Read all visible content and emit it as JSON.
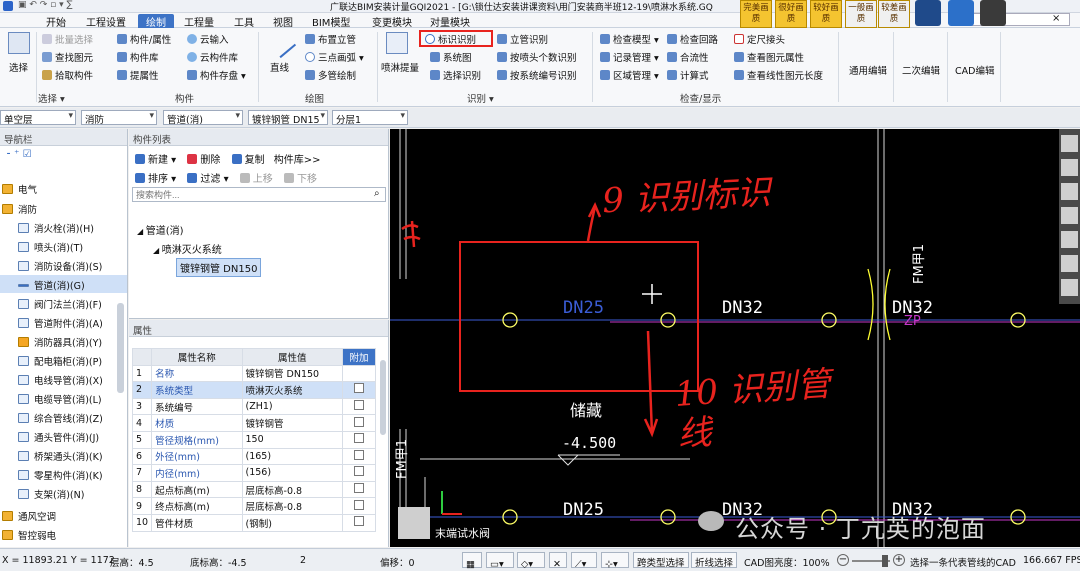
{
  "title_bar": {
    "title": "广联达BIM安装计量GQI2021 - [G:\\锁仕达安装讲课资料\\用门安装商半班12-19\\喷淋水系统.GQ"
  },
  "menu": [
    "开始",
    "工程设置",
    "绘制",
    "工程量",
    "工具",
    "视图",
    "BIM模型",
    "变更模块",
    "对量模块"
  ],
  "badges": [
    "完美画质",
    "很好画质",
    "较好画质",
    "一般画质",
    "较差画质"
  ],
  "ribbon": {
    "select": {
      "btn": "选择",
      "group": "选择 ▾"
    },
    "component": {
      "items": [
        "批量选择",
        "查找图元",
        "拾取构件",
        "构件/属性",
        "构件库",
        "提属性",
        "云输入",
        "云构件库",
        "构件存盘 ▾"
      ],
      "group": "构件"
    },
    "draw": {
      "items": [
        "直线",
        "布置立管",
        "三点画弧 ▾",
        "多管绘制"
      ],
      "group": "绘图"
    },
    "identify": {
      "items": [
        "喷淋提量",
        "标识识别",
        "立管识别",
        "系统图",
        "按喷头个数识别",
        "选择识别",
        "按系统编号识别"
      ],
      "group": "识别 ▾"
    },
    "check": {
      "items": [
        "检查模型 ▾",
        "检查回路",
        "定尺接头",
        "记录管理 ▾",
        "合流性",
        "查看图元属性",
        "区域管理 ▾",
        "计算式",
        "查看线性图元长度"
      ],
      "group": "检查/显示"
    },
    "edit": [
      "通用编辑",
      "二次编辑",
      "CAD编辑"
    ]
  },
  "toolbar": [
    "单空层",
    "消防",
    "管道(消)",
    "镀锌钢管 DN15",
    "分层1"
  ],
  "nav": {
    "header": "导航栏",
    "categories": [
      "电气",
      "消防"
    ],
    "items": [
      "消火栓(消)(H)",
      "喷头(消)(T)",
      "消防设备(消)(S)",
      "管道(消)(G)",
      "阀门法兰(消)(F)",
      "管道附件(消)(A)",
      "消防器具(消)(Y)",
      "配电箱柜(消)(P)",
      "电线导管(消)(X)",
      "电缆导管(消)(L)",
      "综合管线(消)(Z)",
      "通头管件(消)(J)",
      "桥架通头(消)(K)",
      "零星构件(消)(K)",
      "支架(消)(N)"
    ],
    "bottom_categories": [
      "通风空调",
      "智控弱电"
    ]
  },
  "component_list": {
    "header": "构件列表",
    "toolbar1": [
      "新建 ▾",
      "删除",
      "复制",
      "构件库>>"
    ],
    "toolbar2": [
      "排序 ▾",
      "过滤 ▾",
      "上移",
      "下移"
    ],
    "search_placeholder": "搜索构件...",
    "tree": [
      "管道(消)",
      "喷淋灭火系统",
      "镀锌钢管 DN150"
    ]
  },
  "properties": {
    "header": "属性",
    "columns": [
      "属性名称",
      "属性值",
      "附加"
    ],
    "rows": [
      {
        "n": "1",
        "name": "名称",
        "value": "镀锌钢管 DN150"
      },
      {
        "n": "2",
        "name": "系统类型",
        "value": "喷淋灭火系统"
      },
      {
        "n": "3",
        "name": "系统编号",
        "value": "(ZH1)"
      },
      {
        "n": "4",
        "name": "材质",
        "value": "镀锌钢管"
      },
      {
        "n": "5",
        "name": "管径规格(mm)",
        "value": "150"
      },
      {
        "n": "6",
        "name": "外径(mm)",
        "value": "(165)"
      },
      {
        "n": "7",
        "name": "内径(mm)",
        "value": "(156)"
      },
      {
        "n": "8",
        "name": "起点标高(m)",
        "value": "层底标高-0.8"
      },
      {
        "n": "9",
        "name": "终点标高(m)",
        "value": "层底标高-0.8"
      },
      {
        "n": "10",
        "name": "管件材质",
        "value": "(钢制)"
      }
    ]
  },
  "canvas": {
    "pipe_labels": [
      "DN25",
      "DN32",
      "DN32",
      "DN25",
      "DN32",
      "DN32"
    ],
    "fm_label": "FM甲1",
    "zp_label": "ZP",
    "storage_label": "储藏",
    "elevation": "-4.500",
    "end_valve": "末端试水阀",
    "annot_9": "9 识别标识",
    "annot_10": "10 识别管线",
    "watermark": "公众号 · 丁亢英的泡面"
  },
  "status": {
    "coords": "X = 11893.21 Y = 1172",
    "floor": "层高：4.5",
    "bottom": "底标高：-4.5",
    "count": "2",
    "offset": "偏移：0",
    "cross": "跨类型选择",
    "fold": "折线选择",
    "cad_bright": "CAD图亮度：100%",
    "hint": "选择一条代表管线的CAD",
    "fps": "166.667 FPS"
  },
  "colors": {
    "accent": "#3d73c6",
    "annotation": "#e8231e",
    "cad_yellow": "#ffff00",
    "pipe_blue": "#3b5dd6",
    "pipe_magenta": "#c637c9"
  }
}
